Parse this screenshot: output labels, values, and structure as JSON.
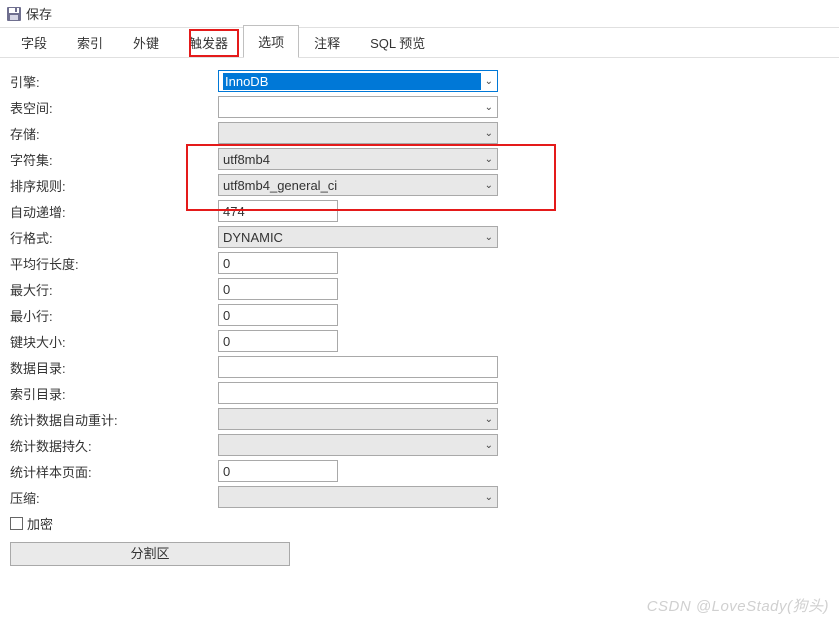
{
  "toolbar": {
    "save_label": "保存"
  },
  "tabs": [
    "字段",
    "索引",
    "外键",
    "触发器",
    "选项",
    "注释",
    "SQL 预览"
  ],
  "active_tab_index": 4,
  "fields": {
    "engine": {
      "label": "引擎:",
      "value": "InnoDB"
    },
    "tablespace": {
      "label": "表空间:",
      "value": ""
    },
    "storage": {
      "label": "存储:",
      "value": ""
    },
    "charset": {
      "label": "字符集:",
      "value": "utf8mb4"
    },
    "collation": {
      "label": "排序规则:",
      "value": "utf8mb4_general_ci"
    },
    "auto_increment": {
      "label": "自动递增:",
      "value": "474"
    },
    "row_format": {
      "label": "行格式:",
      "value": "DYNAMIC"
    },
    "avg_row_length": {
      "label": "平均行长度:",
      "value": "0"
    },
    "max_rows": {
      "label": "最大行:",
      "value": "0"
    },
    "min_rows": {
      "label": "最小行:",
      "value": "0"
    },
    "key_block_size": {
      "label": "键块大小:",
      "value": "0"
    },
    "data_directory": {
      "label": "数据目录:",
      "value": ""
    },
    "index_directory": {
      "label": "索引目录:",
      "value": ""
    },
    "stats_auto_recalc": {
      "label": "统计数据自动重计:",
      "value": ""
    },
    "stats_persistent": {
      "label": "统计数据持久:",
      "value": ""
    },
    "stats_sample_pages": {
      "label": "统计样本页面:",
      "value": "0"
    },
    "compression": {
      "label": "压缩:",
      "value": ""
    },
    "encrypt": {
      "label": "加密",
      "checked": false
    }
  },
  "partition_btn": "分割区",
  "watermark": "CSDN @LoveStady(狗头)"
}
